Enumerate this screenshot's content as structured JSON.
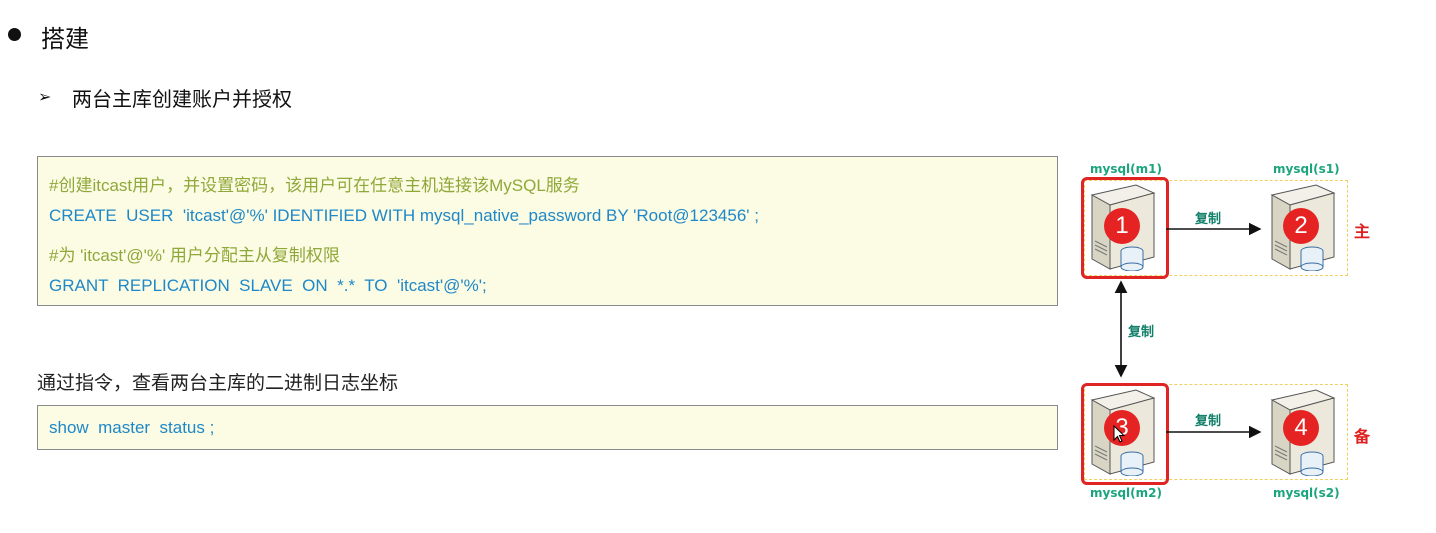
{
  "section": {
    "title": "搭建"
  },
  "step": {
    "title": "两台主库创建账户并授权"
  },
  "code_block_1": {
    "lines": [
      "#创建itcast用户，并设置密码，该用户可在任意主机连接该MySQL服务",
      "CREATE  USER  'itcast'@'%' IDENTIFIED WITH mysql_native_password BY 'Root@123456' ;",
      "#为 'itcast'@'%' 用户分配主从复制权限",
      "GRANT  REPLICATION  SLAVE  ON  *.*  TO  'itcast'@'%';"
    ]
  },
  "note": {
    "text": "通过指令，查看两台主库的二进制日志坐标"
  },
  "code_block_2": {
    "lines": [
      "show  master  status ;"
    ]
  },
  "diagram": {
    "nodes": [
      {
        "label": "mysql(m1)",
        "number": "1"
      },
      {
        "label": "mysql(s1)",
        "number": "2"
      },
      {
        "label": "mysql(m2)",
        "number": "3"
      },
      {
        "label": "mysql(s2)",
        "number": "4"
      }
    ],
    "replication_labels": [
      "复制",
      "复制",
      "复制"
    ],
    "group_labels": [
      "主",
      "备"
    ],
    "colors": {
      "label_green": "#1ca57d",
      "badge_red": "#e62323",
      "frame_red": "#e02424",
      "group_dash": "#f0d060"
    }
  }
}
